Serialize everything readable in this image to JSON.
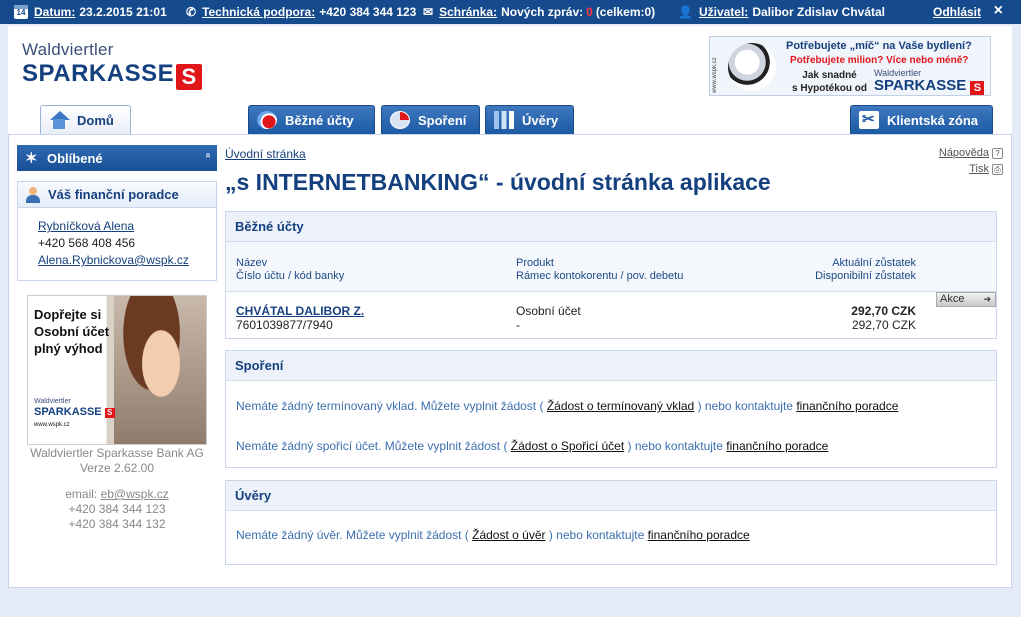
{
  "topbar": {
    "date_label": "Datum:",
    "date_value": "23.2.2015 21:01",
    "support_label": "Technická podpora:",
    "support_value": "+420 384 344 123",
    "inbox_label": "Schránka:",
    "inbox_text": "Nových zpráv:",
    "inbox_new": "0",
    "inbox_total": "(celkem:0)",
    "calendar_day": "14",
    "user_label": "Uživatel:",
    "user_value": "Dalibor Zdislav Chvátal",
    "logout": "Odhlásit",
    "close": "×"
  },
  "logo": {
    "line1": "Waldviertler",
    "line2": "SPARKASSE",
    "s_mark": "S"
  },
  "banner": {
    "side": "www.wspk.cz",
    "line1": "Potřebujete „míč“ na Vaše bydlení?",
    "line2": "Potřebujete milion? Více nebo méně?",
    "line3": "Jak snadné",
    "line4": "s Hypotékou od",
    "brand1": "Waldviertler",
    "brand2": "SPARKASSE",
    "s_mark": "S"
  },
  "tabs": {
    "home": "Domů",
    "accounts": "Běžné účty",
    "savings": "Spoření",
    "loans": "Úvěry",
    "client": "Klientská zóna"
  },
  "sidebar": {
    "favorites": "Oblíbené",
    "chevron": "»",
    "advisor_title": "Váš finanční poradce",
    "advisor_name": "Rybníčková Alena",
    "advisor_phone": "+420 568 408 456",
    "advisor_email": "Alena.Rybnickova@wspk.cz",
    "promo_line1": "Dopřejte si",
    "promo_line2": "Osobní účet",
    "promo_line3": "plný výhod",
    "promo_brand1": "Waldviertler",
    "promo_brand2": "SPARKASSE",
    "promo_s_mark": "S",
    "promo_url": "www.wspk.cz",
    "bank_name": "Waldviertler Sparkasse Bank AG",
    "version": "Verze 2.62.00",
    "email_label": "email:",
    "email_value": "eb@wspk.cz",
    "phone1": "+420 384 344 123",
    "phone2": "+420 384 344 132"
  },
  "main": {
    "breadcrumb": "Úvodní stránka",
    "help": "Nápověda",
    "help_icon": "?",
    "print": "Tisk",
    "print_icon": "⎙",
    "title": "„s INTERNETBANKING“ - úvodní stránka aplikace"
  },
  "accounts": {
    "title": "Běžné účty",
    "head_name": "Název",
    "head_number": "Číslo účtu / kód banky",
    "head_product": "Produkt",
    "head_overdraft": "Rámec kontokorentu / pov. debetu",
    "head_balance": "Aktuální zůstatek",
    "head_available": "Disponibilní zůstatek",
    "rows": [
      {
        "name": "CHVÁTAL DALIBOR Z.",
        "number": "7601039877/7940",
        "product": "Osobní účet",
        "overdraft": "-",
        "balance": "292,70 CZK",
        "available": "292,70 CZK",
        "action": "Akce",
        "action_arrow": "➜"
      }
    ]
  },
  "savings": {
    "title": "Spoření",
    "msg1_pre": "Nemáte žádný termínovaný vklad. Můžete vyplnit žádost (",
    "msg1_link": "Žádost o termínovaný vklad",
    "msg1_mid": ") nebo kontaktujte",
    "msg1_link2": "finančního poradce",
    "msg2_pre": "Nemáte žádný spořicí účet. Můžete vyplnit žádost (",
    "msg2_link": "Žádost o Spořicí účet",
    "msg2_mid": ") nebo kontaktujte",
    "msg2_link2": "finančního poradce"
  },
  "loans": {
    "title": "Úvěry",
    "msg_pre": "Nemáte žádný úvěr. Můžete vyplnit žádost (",
    "msg_link": "Žádost o úvěr",
    "msg_mid": ") nebo kontaktujte",
    "msg_link2": "finančního poradce"
  }
}
